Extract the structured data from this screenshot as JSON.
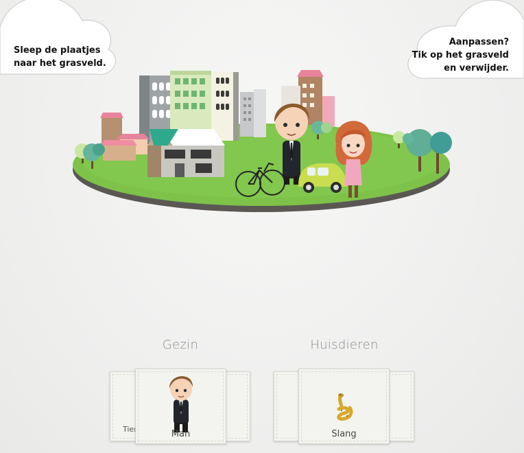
{
  "instructions": {
    "left_line1": "Sleep de plaatjes",
    "left_line2": "naar het grasveld.",
    "right_line1": "Aanpassen?",
    "right_line2": "Tik op het grasveld",
    "right_line3": "en verwijder."
  },
  "categories": [
    {
      "title": "Gezin",
      "selected_card": "Man",
      "previous_card_partial": "Tier",
      "icon": "man-icon"
    },
    {
      "title": "Huisdieren",
      "selected_card": "Slang",
      "icon": "snake-icon"
    }
  ],
  "scene_items": [
    "woman-icon",
    "man-icon",
    "bicycle-icon",
    "car-icon",
    "houses-icon",
    "trees-icon"
  ],
  "colors": {
    "grass": "#7ec24a",
    "grass_edge": "#5d5a55",
    "car": "#c9dd4e",
    "woman_hair": "#d2693a",
    "dress": "#f2a7c0"
  }
}
